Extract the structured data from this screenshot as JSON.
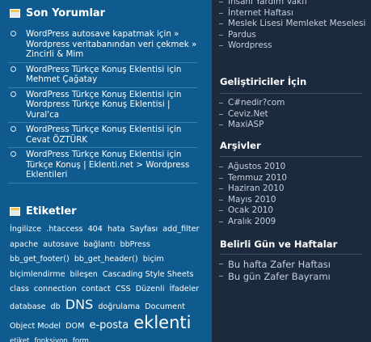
{
  "left": {
    "recent": {
      "title": "Son Yorumlar",
      "items": [
        "WordPress autosave kapatmak için » Wordpress veritabanından veri çekmek » Zincirli & Mim",
        "WordPress Türkçe Konuş Eklentisi için Mehmet Çağatay",
        "WordPress Türkçe Konuş Eklentisi için Wordpress Türkçe Konuş Eklentisi | Vural'ca",
        "WordPress Türkçe Konuş Eklentisi için Cevat ÖZTÜRK",
        "WordPress Türkçe Konuş Eklentisi için Türkçe Konuş | Eklenti.net > Wordpress Eklentileri"
      ]
    },
    "tags": {
      "title": "Etiketler",
      "items": [
        {
          "text": "İngilizce",
          "size": "s"
        },
        {
          "text": ".htaccess",
          "size": "s"
        },
        {
          "text": "404",
          "size": "s"
        },
        {
          "text": "hata",
          "size": "s"
        },
        {
          "text": "Sayfası",
          "size": "s"
        },
        {
          "text": "add_filter",
          "size": "s"
        },
        {
          "text": "apache",
          "size": "s"
        },
        {
          "text": "autosave",
          "size": "s"
        },
        {
          "text": "bağlantı",
          "size": "s"
        },
        {
          "text": "bbPress",
          "size": "s"
        },
        {
          "text": "bb_get_footer()",
          "size": "s"
        },
        {
          "text": "bb_get_header()",
          "size": "s"
        },
        {
          "text": "biçim",
          "size": "s"
        },
        {
          "text": "biçimlendirme",
          "size": "s"
        },
        {
          "text": "bileşen",
          "size": "s"
        },
        {
          "text": "Cascading Style Sheets",
          "size": "s"
        },
        {
          "text": "class",
          "size": "s"
        },
        {
          "text": "connection",
          "size": "s"
        },
        {
          "text": "contact",
          "size": "s"
        },
        {
          "text": "CSS",
          "size": "s"
        },
        {
          "text": "Düzenli",
          "size": "s"
        },
        {
          "text": "İfadeler",
          "size": "s"
        },
        {
          "text": "database",
          "size": "s"
        },
        {
          "text": "db",
          "size": "s"
        },
        {
          "text": "DNS",
          "size": "l"
        },
        {
          "text": "doğrulama",
          "size": "s"
        },
        {
          "text": "Document Object Model",
          "size": "s"
        },
        {
          "text": "DOM",
          "size": "s"
        },
        {
          "text": "e-posta",
          "size": "m"
        },
        {
          "text": "eklenti",
          "size": "xl"
        },
        {
          "text": "etiket",
          "size": "xs"
        },
        {
          "text": "fonksiyon",
          "size": "xs"
        },
        {
          "text": "form",
          "size": "xs"
        }
      ]
    }
  },
  "right": {
    "top_links": [
      "İnsani Yardım Vakfı",
      "İnternet Haftası",
      "Meslek Lisesi Memleket Meselesi",
      "Pardus",
      "Wordpress"
    ],
    "developers": {
      "title": "Geliştiriciler İçin",
      "links": [
        "C#nedir?com",
        "Ceviz.Net",
        "MaxiASP"
      ]
    },
    "archives": {
      "title": "Arşivler",
      "links": [
        "Ağustos 2010",
        "Temmuz 2010",
        "Haziran 2010",
        "Mayıs 2010",
        "Ocak 2010",
        "Aralık 2009"
      ]
    },
    "days": {
      "title": "Belirli Gün ve Haftalar",
      "links": [
        "Bu hafta Zafer Haftası",
        "Bu gün Zafer Bayramı"
      ]
    }
  }
}
